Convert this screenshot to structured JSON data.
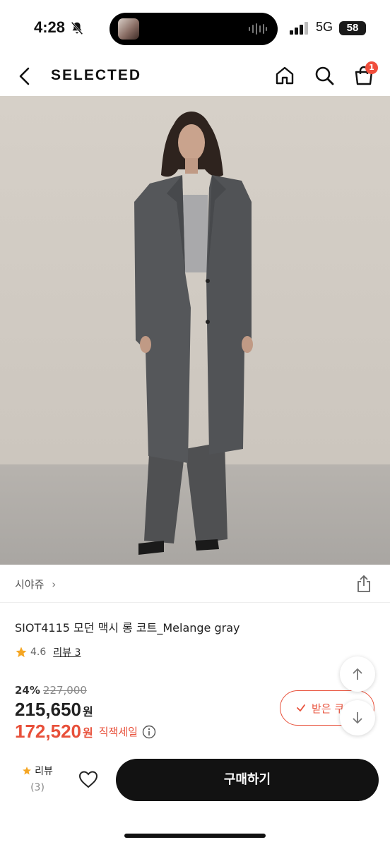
{
  "status_bar": {
    "time": "4:28",
    "network": "5G",
    "battery": "58",
    "icons": [
      "bell-slash-icon",
      "waveform-icon",
      "signal-icon"
    ]
  },
  "nav": {
    "logo": "SELECTED",
    "cart_count": "1",
    "icons": [
      "back-chevron-icon",
      "home-icon",
      "search-icon",
      "bag-icon"
    ]
  },
  "product": {
    "brand": "시야쥬",
    "brand_chevron": "›",
    "title": "SIOT4115 모던 맥시 롱 코트_Melange gray",
    "rating": "4.6",
    "review_link": "리뷰 3",
    "discount_pct": "24%",
    "original_price": "227,000",
    "price": "215,650",
    "price_unit": "원",
    "sale_price": "172,520",
    "sale_unit": "원",
    "sale_label": "직잭세일"
  },
  "coupon": {
    "label": "받은 쿠"
  },
  "bottom_bar": {
    "review_label": "리뷰",
    "review_count": "(3)",
    "buy_label": "구매하기"
  },
  "colors": {
    "accent": "#e8503a",
    "buy_button": "#121212",
    "badge": "#f04e3c",
    "star": "#f5a623"
  }
}
